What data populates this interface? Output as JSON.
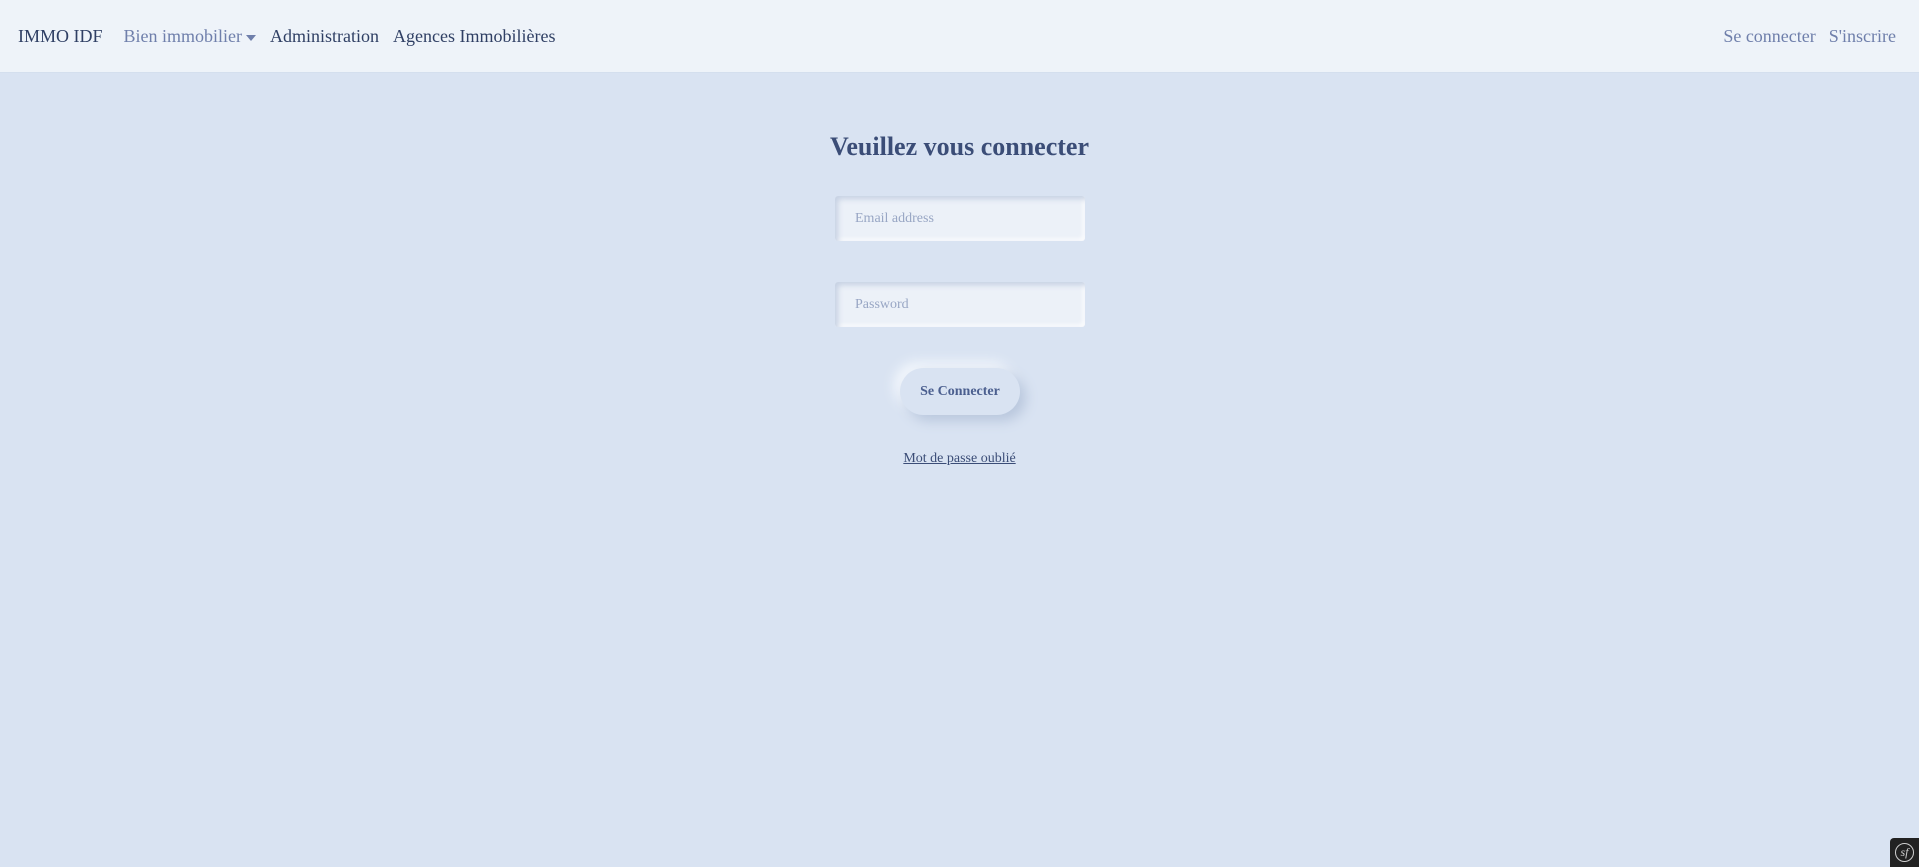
{
  "navbar": {
    "brand": "IMMO IDF",
    "items": [
      {
        "label": "Bien immobilier",
        "dropdown": true
      },
      {
        "label": "Administration"
      },
      {
        "label": "Agences Immobilières"
      }
    ],
    "right_items": [
      {
        "label": "Se connecter"
      },
      {
        "label": "S'inscrire"
      }
    ]
  },
  "login": {
    "title": "Veuillez vous connecter",
    "email_placeholder": "Email address",
    "password_placeholder": "Password",
    "submit_label": "Se Connecter",
    "forgot_label": "Mot de passe oublié"
  },
  "debug_toolbar": {
    "icon": "symfony-logo-icon",
    "glyph": "sf"
  },
  "colors": {
    "background": "#d9e3f2",
    "navbar": "#eef3f9",
    "text_dark": "#2f3f64",
    "text_muted": "#6f7fab"
  }
}
